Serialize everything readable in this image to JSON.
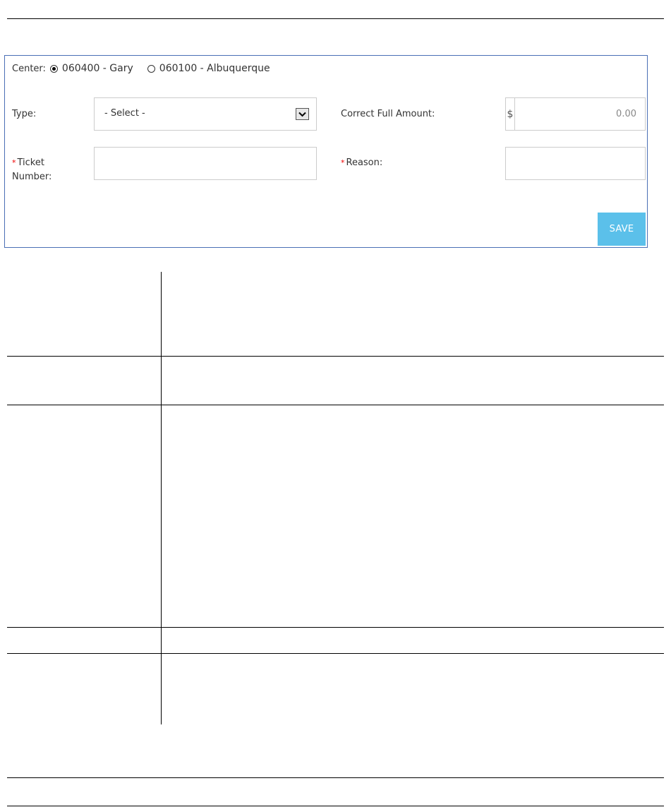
{
  "form": {
    "center": {
      "label": "Center:",
      "options": [
        {
          "label": "060400 - Gary",
          "selected": true
        },
        {
          "label": "060100 - Albuquerque",
          "selected": false
        }
      ]
    },
    "type": {
      "label": "Type:",
      "selected": "- Select -"
    },
    "correct_full_amount": {
      "label": "Correct Full Amount:",
      "currency_symbol": "$",
      "value": "0.00"
    },
    "ticket_number": {
      "required_marker": "*",
      "label_line1": "Ticket",
      "label_line2": "Number:",
      "value": ""
    },
    "reason": {
      "required_marker": "*",
      "label": "Reason:",
      "value": ""
    },
    "save_label": "SAVE",
    "colors": {
      "border": "#4a6fb5",
      "save_button": "#5bc0ea",
      "required": "#e00000"
    }
  },
  "icons": {
    "select_arrow": "chevron-down-icon"
  }
}
